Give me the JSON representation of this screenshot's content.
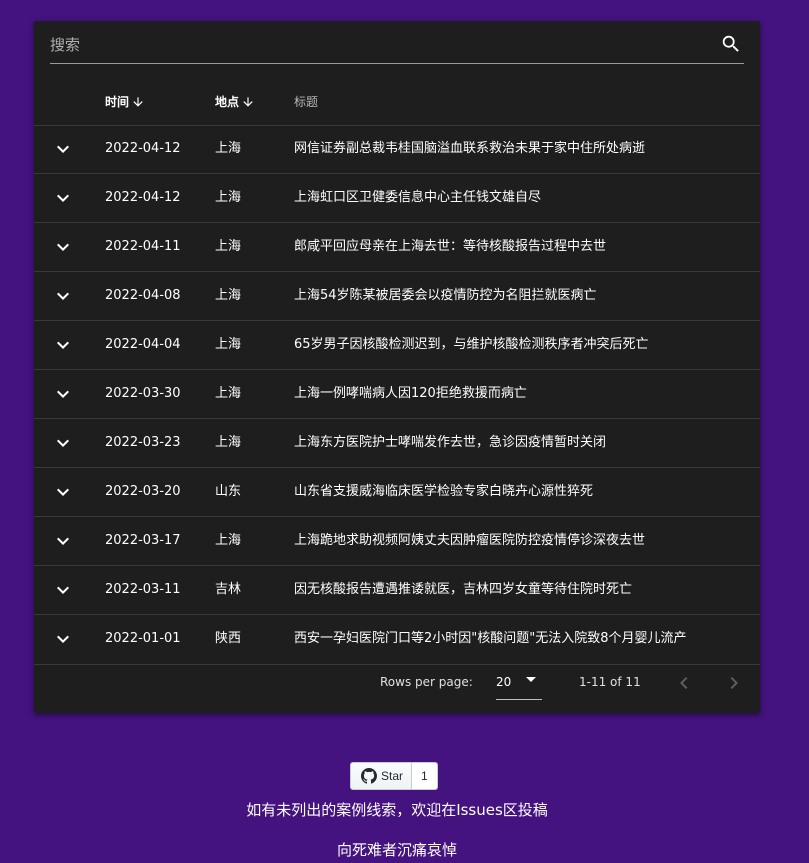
{
  "search": {
    "placeholder": "搜索"
  },
  "table": {
    "columns": {
      "time": "时间",
      "place": "地点",
      "title": "标题"
    },
    "rows": [
      {
        "date": "2022-04-12",
        "place": "上海",
        "title": "网信证券副总裁韦桂国脑溢血联系救治未果于家中住所处病逝"
      },
      {
        "date": "2022-04-12",
        "place": "上海",
        "title": "上海虹口区卫健委信息中心主任钱文雄自尽"
      },
      {
        "date": "2022-04-11",
        "place": "上海",
        "title": "郎咸平回应母亲在上海去世：等待核酸报告过程中去世"
      },
      {
        "date": "2022-04-08",
        "place": "上海",
        "title": "上海54岁陈某被居委会以疫情防控为名阻拦就医病亡"
      },
      {
        "date": "2022-04-04",
        "place": "上海",
        "title": "65岁男子因核酸检测迟到，与维护核酸检测秩序者冲突后死亡"
      },
      {
        "date": "2022-03-30",
        "place": "上海",
        "title": "上海一例哮喘病人因120拒绝救援而病亡"
      },
      {
        "date": "2022-03-23",
        "place": "上海",
        "title": "上海东方医院护士哮喘发作去世，急诊因疫情暂时关闭"
      },
      {
        "date": "2022-03-20",
        "place": "山东",
        "title": "山东省支援威海临床医学检验专家白晓卉心源性猝死"
      },
      {
        "date": "2022-03-17",
        "place": "上海",
        "title": "上海跪地求助视频阿姨丈夫因肿瘤医院防控疫情停诊深夜去世"
      },
      {
        "date": "2022-03-11",
        "place": "吉林",
        "title": "因无核酸报告遭遇推诿就医，吉林四岁女童等待住院时死亡"
      },
      {
        "date": "2022-01-01",
        "place": "陕西",
        "title": "西安一孕妇医院门口等2小时因\"核酸问题\"无法入院致8个月婴儿流产"
      }
    ]
  },
  "pagination": {
    "rows_per_page_label": "Rows per page:",
    "rows_per_page_value": "20",
    "range_text": "1-11 of 11"
  },
  "github": {
    "star_label": "Star",
    "star_count": "1"
  },
  "footer": {
    "line1": "如有未列出的案例线索，欢迎在Issues区投稿",
    "line2": "向死难者沉痛哀悼"
  },
  "colors": {
    "background": "#44137f",
    "card": "#1e1e1e",
    "divider": "#3a3a3a"
  },
  "icons": [
    "search-icon",
    "arrow-down-icon",
    "chevron-down-icon",
    "chevron-left-icon",
    "chevron-right-icon",
    "github-icon",
    "caret-down-icon"
  ]
}
